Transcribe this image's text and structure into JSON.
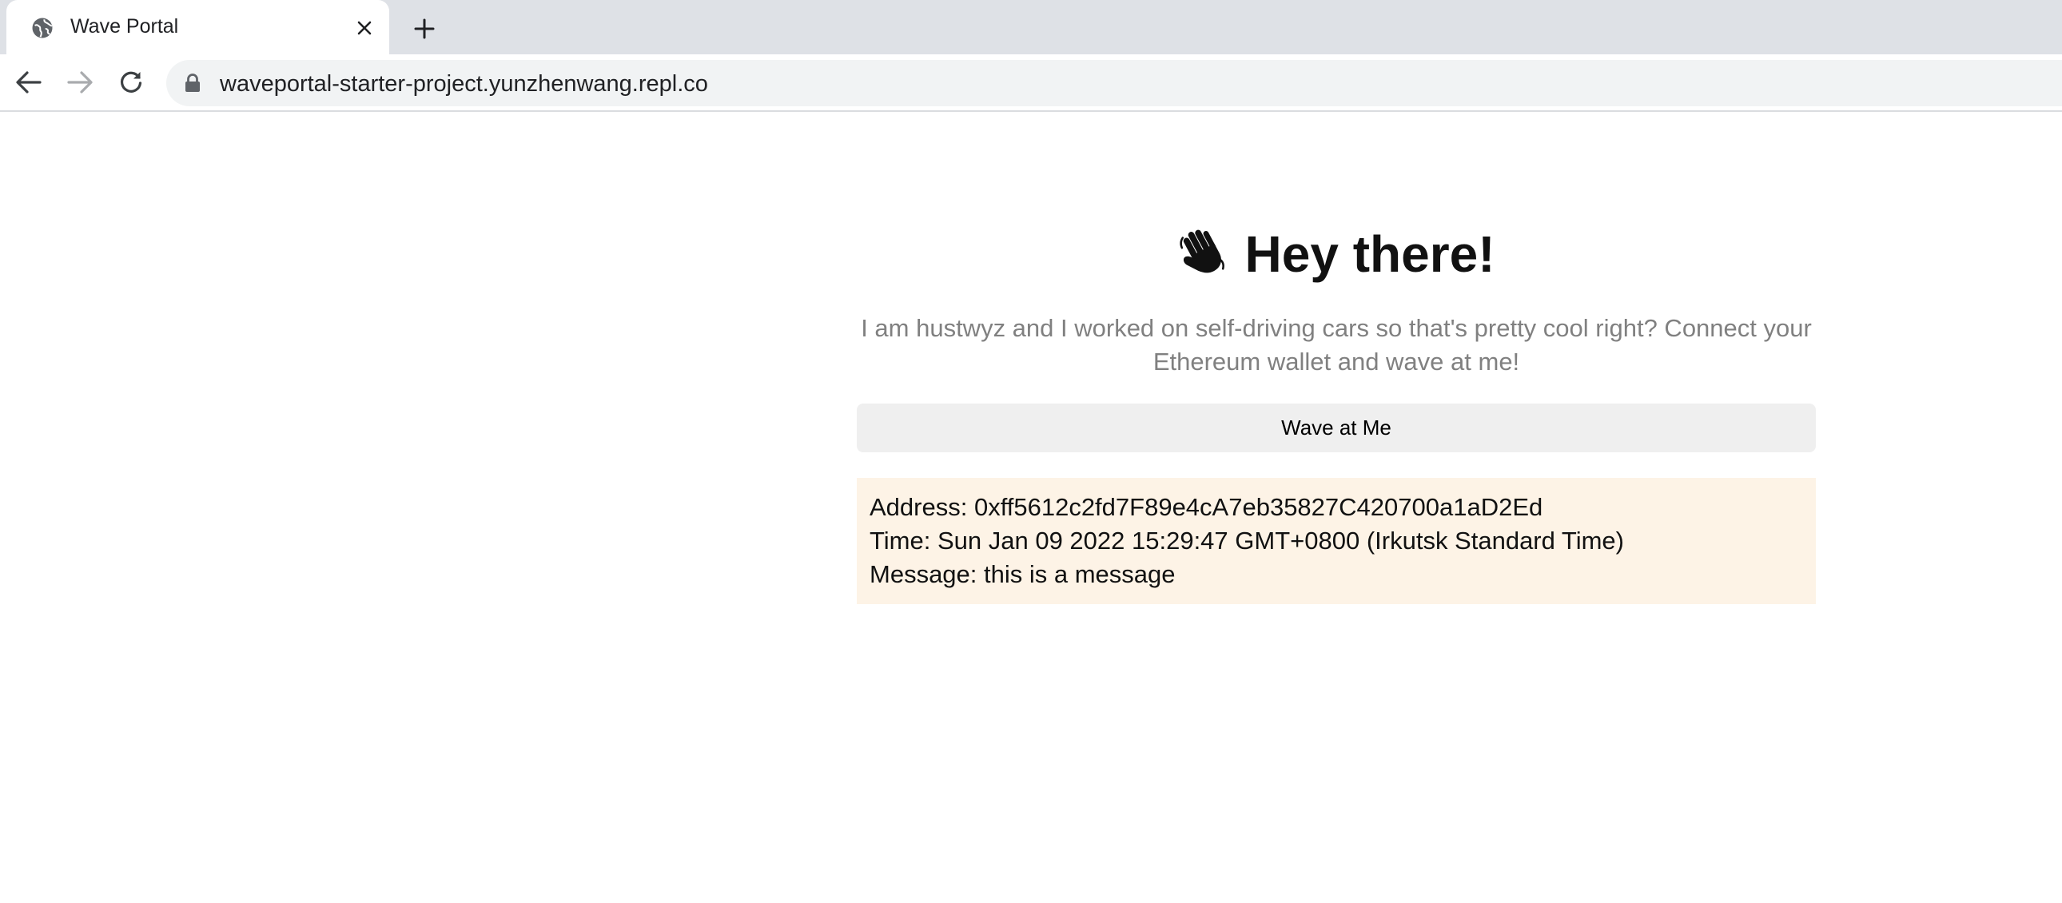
{
  "browser": {
    "tab": {
      "title": "Wave Portal",
      "favicon": "globe-icon"
    },
    "address_bar": {
      "url": "waveportal-starter-project.yunzhenwang.repl.co",
      "security": "lock-icon"
    },
    "icons": {
      "back": "arrow-left-icon",
      "forward": "arrow-right-icon",
      "reload": "reload-icon",
      "close_tab": "close-icon",
      "new_tab": "plus-icon"
    }
  },
  "page": {
    "header": {
      "emoji": "waving-hand-icon",
      "title": "Hey there!"
    },
    "bio": "I am hustwyz and I worked on self-driving cars so that's pretty cool right? Connect your Ethereum wallet and wave at me!",
    "wave_button_label": "Wave at Me",
    "waves": [
      {
        "address": "Address: 0xff5612c2fd7F89e4cA7eb35827C420700a1aD2Ed",
        "time": "Time: Sun Jan 09 2022 15:29:47 GMT+0800 (Irkutsk Standard Time)",
        "message": "Message: this is a message"
      }
    ]
  },
  "colors": {
    "tabstrip_bg": "#dee1e6",
    "omnibox_bg": "#f1f3f4",
    "bio_text": "#808080",
    "button_bg": "#efefef",
    "wave_card_bg": "#fdf3e6"
  }
}
